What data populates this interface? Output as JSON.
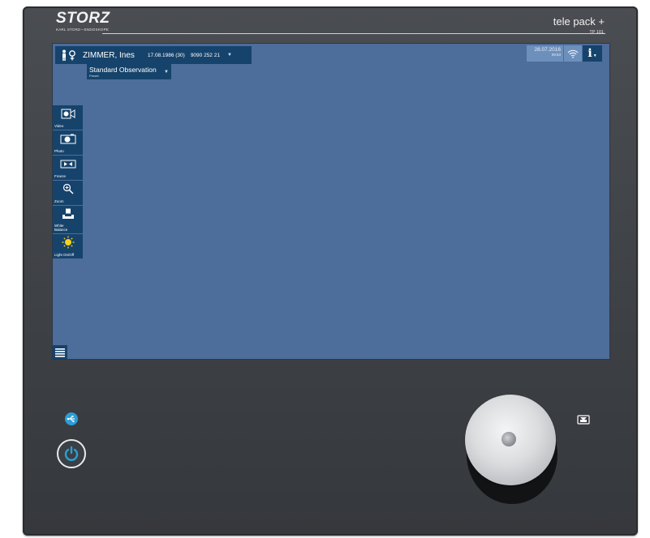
{
  "device": {
    "brand": "STORZ",
    "brand_sub": "KARL STORZ—ENDOSKOPE",
    "product_name": "tele pack +",
    "product_model": "TP 101"
  },
  "patient": {
    "name": "ZIMMER, Ines",
    "dob": "17.08.1986 (30)",
    "id": "9090 252 21"
  },
  "preset": {
    "title": "Standard Observation",
    "sub": "Preset"
  },
  "status": {
    "date": "28.07.2016",
    "time": "09:53"
  },
  "toolbar": {
    "items": [
      {
        "label": "Video",
        "icon": "video-camera-icon"
      },
      {
        "label": "Photo",
        "icon": "camera-icon"
      },
      {
        "label": "Freeze",
        "icon": "freeze-icon"
      },
      {
        "label": "Zoom",
        "icon": "zoom-icon"
      },
      {
        "label": "White\nBalance",
        "icon": "white-balance-icon"
      },
      {
        "label": "Light On/Off",
        "icon": "light-icon"
      }
    ]
  },
  "colors": {
    "screen": "#4d6d9a",
    "panel": "#16436b",
    "panel_light": "#6d8fbb",
    "accent_cyan": "#2a9fd6",
    "light_yellow": "#f7d21a"
  }
}
